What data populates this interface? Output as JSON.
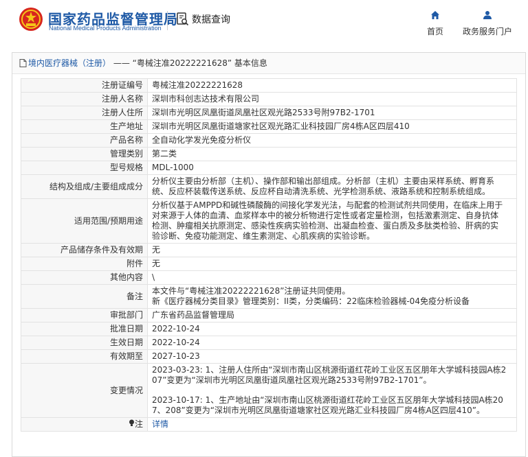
{
  "header": {
    "logo_cn": "国家药品监督管理局",
    "logo_en": "National Medical Products Administration",
    "query_label": "数据查询",
    "nav": [
      {
        "label": "首页",
        "icon": "home-icon"
      },
      {
        "label": "政务服务门户",
        "icon": "user-icon"
      }
    ]
  },
  "breadcrumb": {
    "category": "境内医疗器械（注册）",
    "separator": " —— ",
    "title": "“粤械注准20222221628” 基本信息"
  },
  "rows": [
    {
      "label": "注册证编号",
      "value": "粤械注准20222221628"
    },
    {
      "label": "注册人名称",
      "value": "深圳市科创志达技术有限公司"
    },
    {
      "label": "注册人住所",
      "value": "深圳市光明区凤凰街道凤凰社区观光路2533号附97B2-1701"
    },
    {
      "label": "生产地址",
      "value": "深圳市光明区凤凰街道塘家社区观光路汇业科技园厂房4栋A区四层410"
    },
    {
      "label": "产品名称",
      "value": "全自动化学发光免疫分析仪"
    },
    {
      "label": "管理类别",
      "value": "第二类"
    },
    {
      "label": "型号规格",
      "value": "MDL-1000"
    },
    {
      "label": "结构及组成/主要组成成分",
      "value": "分析仪主要由分析部（主机）、操作部和输出部组成。分析部（主机）主要由采样系统、孵育系\n统、反应杯装载传送系统、反应杯自动清洗系统、光学检测系统、液路系统和控制系统组成。"
    },
    {
      "label": "适用范围/预期用途",
      "value": "分析仪基于AMPPD和碱性磷酸酶的间接化学发光法，与配套的检测试剂共同使用，在临床上用于\n对来源于人体的血清、血浆样本中的被分析物进行定性或者定量检测，包括激素测定、自身抗体\n检测、肿瘤相关抗原测定、感染性疾病实验检测、出凝血检查、蛋白质及多肽类检验、肝病的实\n验诊断、免疫功能测定、维生素测定、心肌疾病的实验诊断。"
    },
    {
      "label": "产品储存条件及有效期",
      "value": "无"
    },
    {
      "label": "附件",
      "value": "无"
    },
    {
      "label": "其他内容",
      "value": "\\"
    },
    {
      "label": "备注",
      "value": "本文件与“粤械注准20222221628”注册证共同使用。\n新《医疗器械分类目录》管理类别：II类，分类编码：22临床检验器械-04免疫分析设备"
    },
    {
      "label": "审批部门",
      "value": "广东省药品监督管理局"
    },
    {
      "label": "批准日期",
      "value": "2022-10-24"
    },
    {
      "label": "生效日期",
      "value": "2022-10-24"
    },
    {
      "label": "有效期至",
      "value": "2027-10-23"
    }
  ],
  "changes": {
    "label": "变更情况",
    "entries": [
      "2023-03-23: 1、注册人住所由“深圳市南山区桃源街道红花岭工业区五区朋年大学城科技园A栋2\n07”变更为“深圳市光明区凤凰街道凤凰社区观光路2533号附97B2-1701”。",
      "2023-10-17: 1、生产地址由“深圳市南山区桃源街道红花岭工业区五区朋年大学城科技园A栋20\n7、208”变更为“深圳市光明区凤凰街道塘家社区观光路汇业科技园厂房4栋A区四层410”。"
    ]
  },
  "note": {
    "label": "注",
    "link": "详情"
  },
  "colors": {
    "brand": "#1f5aa6",
    "emblem_red": "#d7261e",
    "emblem_gold": "#f5c518"
  }
}
